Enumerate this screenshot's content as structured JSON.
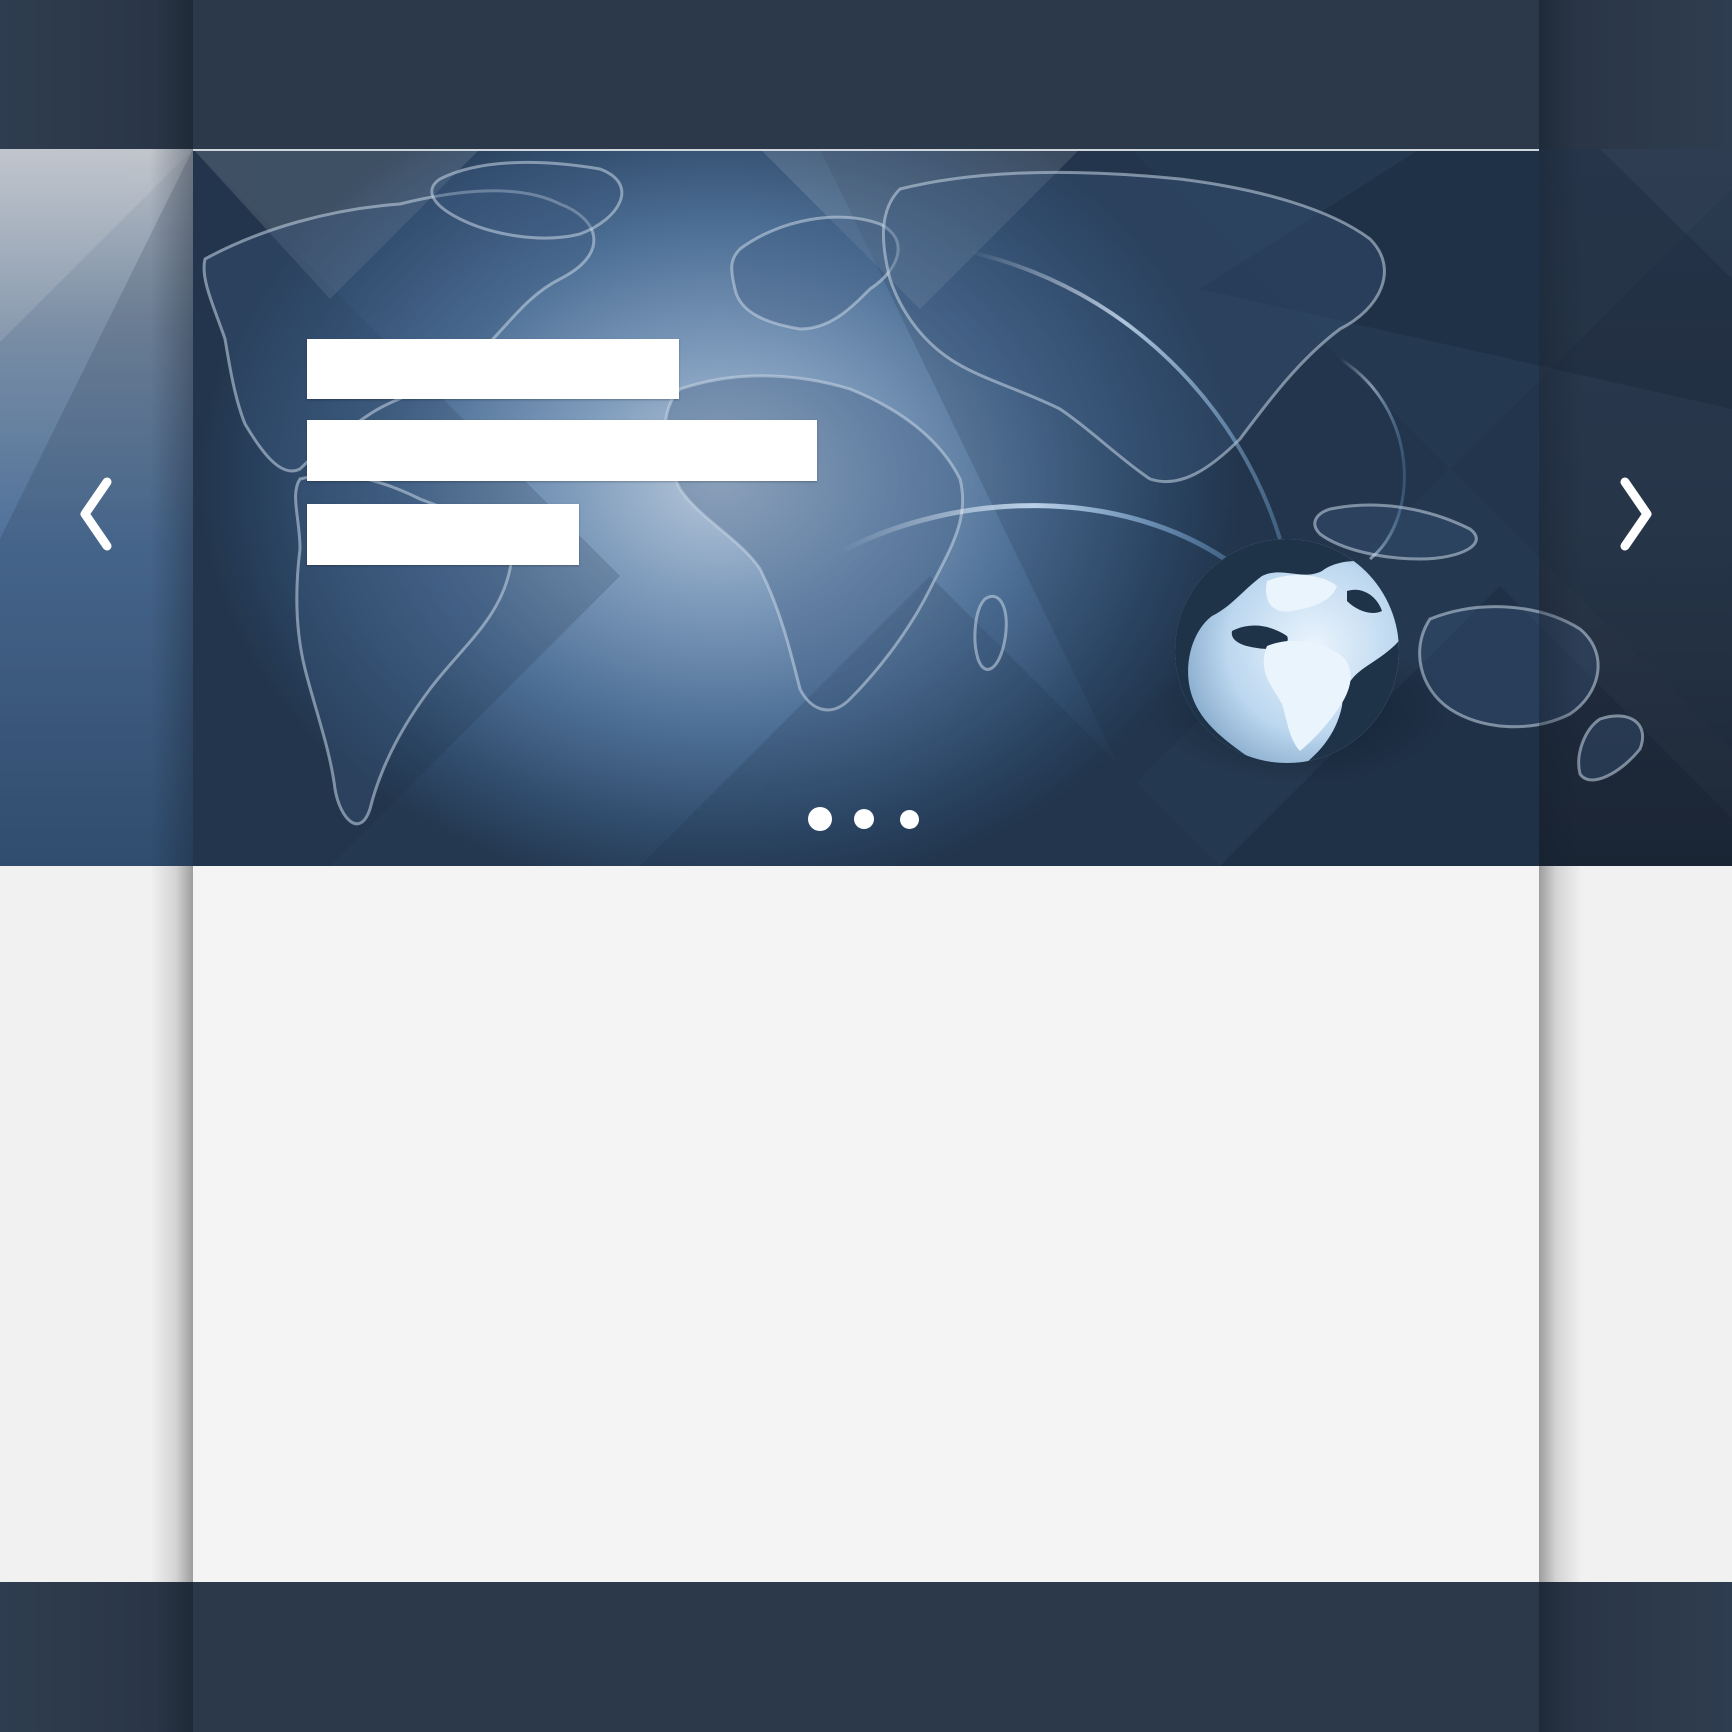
{
  "page": {
    "colors": {
      "dark_bar": "#2c394b",
      "content_bg": "#f4f4f4",
      "hero_blue": "#4d6f95",
      "globe_light": "#cfe3f6",
      "globe_dark": "#1f3348",
      "white": "#ffffff"
    }
  },
  "hero": {
    "text_placeholders": 3,
    "prev_icon": "chevron-left-icon",
    "next_icon": "chevron-right-icon",
    "slides": 3,
    "active_slide": 1,
    "globe_icon": "globe-icon",
    "world_map": "world-map"
  },
  "content": {}
}
